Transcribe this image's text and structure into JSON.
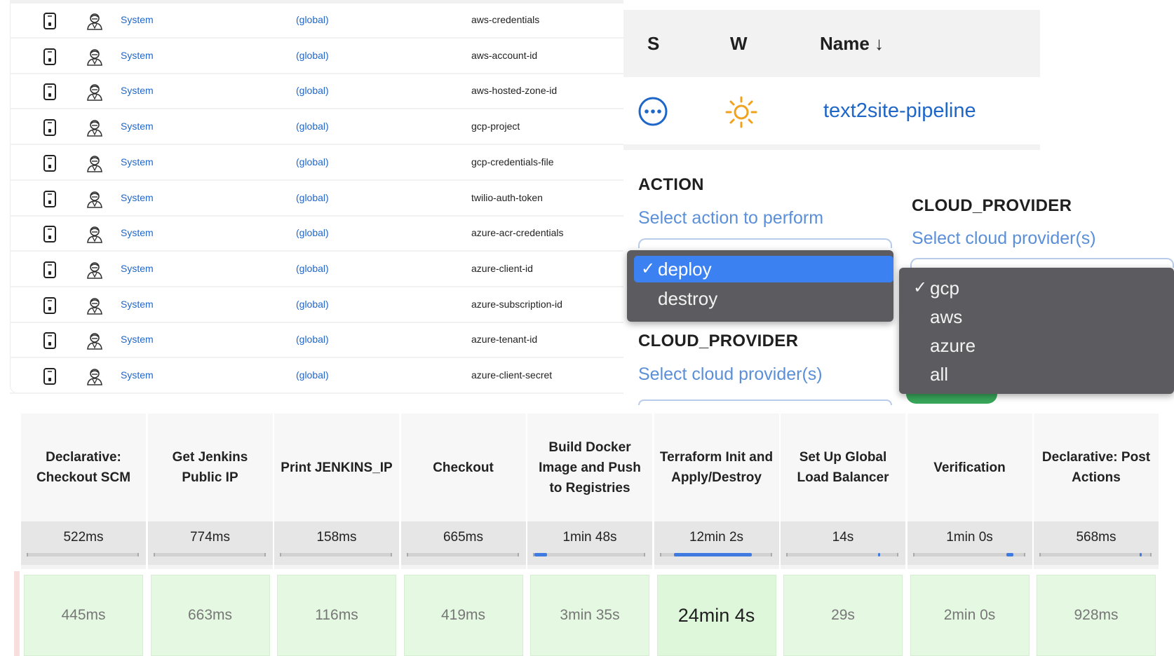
{
  "credentials": {
    "rows": [
      {
        "store": "System",
        "domain": "(global)",
        "id": "aws-credentials"
      },
      {
        "store": "System",
        "domain": "(global)",
        "id": "aws-account-id"
      },
      {
        "store": "System",
        "domain": "(global)",
        "id": "aws-hosted-zone-id"
      },
      {
        "store": "System",
        "domain": "(global)",
        "id": "gcp-project"
      },
      {
        "store": "System",
        "domain": "(global)",
        "id": "gcp-credentials-file"
      },
      {
        "store": "System",
        "domain": "(global)",
        "id": "twilio-auth-token"
      },
      {
        "store": "System",
        "domain": "(global)",
        "id": "azure-acr-credentials"
      },
      {
        "store": "System",
        "domain": "(global)",
        "id": "azure-client-id"
      },
      {
        "store": "System",
        "domain": "(global)",
        "id": "azure-subscription-id"
      },
      {
        "store": "System",
        "domain": "(global)",
        "id": "azure-tenant-id"
      },
      {
        "store": "System",
        "domain": "(global)",
        "id": "azure-client-secret"
      }
    ],
    "icons": [
      "phone-icon",
      "user-secret-icon"
    ]
  },
  "jobs": {
    "headers": {
      "s": "S",
      "w": "W",
      "name": "Name ↓"
    },
    "rows": [
      {
        "status_icon": "in-progress-icon",
        "weather_icon": "sun-icon",
        "name": "text2site-pipeline"
      }
    ]
  },
  "params": {
    "action": {
      "label": "ACTION",
      "description": "Select action to perform",
      "options": [
        {
          "label": "deploy",
          "selected": true
        },
        {
          "label": "destroy",
          "selected": false
        }
      ]
    },
    "cloud_provider_left": {
      "label": "CLOUD_PROVIDER",
      "description": "Select cloud provider(s)"
    },
    "cloud_provider_right": {
      "label": "CLOUD_PROVIDER",
      "description": "Select cloud provider(s)",
      "options": [
        {
          "label": "gcp",
          "selected": true
        },
        {
          "label": "aws",
          "selected": false
        },
        {
          "label": "azure",
          "selected": false
        },
        {
          "label": "all",
          "selected": false
        }
      ]
    }
  },
  "stages": {
    "columns": [
      {
        "name": "Declarative: Checkout SCM",
        "avg": "522ms",
        "run": "445ms",
        "bar_start": 0.0,
        "bar_fraction": 0.0
      },
      {
        "name": "Get Jenkins Public IP",
        "avg": "774ms",
        "run": "663ms",
        "bar_start": 0.0,
        "bar_fraction": 0.0
      },
      {
        "name": "Print JENKINS_IP",
        "avg": "158ms",
        "run": "116ms",
        "bar_start": 0.0,
        "bar_fraction": 0.0
      },
      {
        "name": "Checkout",
        "avg": "665ms",
        "run": "419ms",
        "bar_start": 0.0,
        "bar_fraction": 0.0
      },
      {
        "name": "Build Docker Image and Push to Registries",
        "avg": "1min 48s",
        "run": "3min 35s",
        "bar_start": 0.0,
        "bar_fraction": 0.13
      },
      {
        "name": "Terraform Init and Apply/Destroy",
        "avg": "12min 2s",
        "run": "24min 4s",
        "bar_start": 0.13,
        "bar_fraction": 0.78
      },
      {
        "name": "Set Up Global Load Balancer",
        "avg": "14s",
        "run": "29s",
        "bar_start": 0.91,
        "bar_fraction": 0.01
      },
      {
        "name": "Verification",
        "avg": "1min 0s",
        "run": "2min 0s",
        "bar_start": 0.92,
        "bar_fraction": 0.07
      },
      {
        "name": "Declarative: Post Actions",
        "avg": "568ms",
        "run": "928ms",
        "bar_start": 0.99,
        "bar_fraction": 0.005
      }
    ],
    "highlight_index": 5
  },
  "colors": {
    "link": "#1f66c9",
    "selected_option": "#3c81f2",
    "menu_bg": "#5c5c60",
    "success_cell": "#e5f9e2",
    "progress": "#3f7ae0"
  }
}
